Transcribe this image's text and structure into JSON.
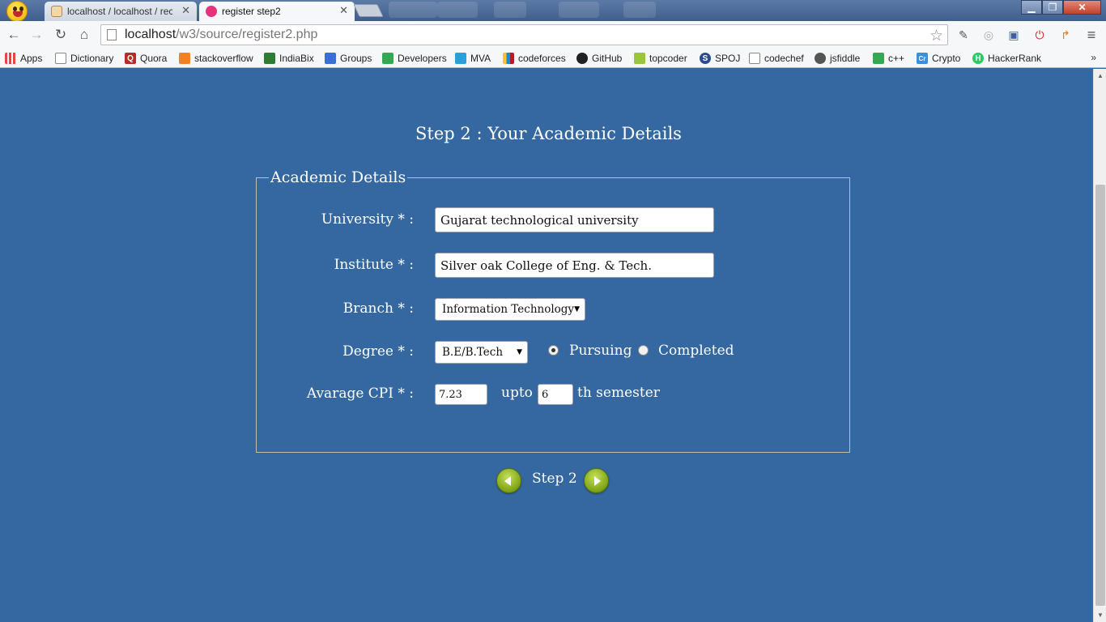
{
  "browser": {
    "tabs": [
      {
        "title": "localhost / localhost / rec",
        "favicon": "phpmyadmin-icon",
        "active": false
      },
      {
        "title": "register step2",
        "favicon": "page-icon",
        "active": true
      }
    ],
    "close_glyph": "✕",
    "url_host": "localhost",
    "url_path": "/w3/source/register2.php",
    "bookmarks": [
      {
        "label": "Apps",
        "icon": "apps-icon",
        "color": "#e8453c"
      },
      {
        "label": "Dictionary",
        "icon": "page-icon",
        "color": "#ffffff"
      },
      {
        "label": "Quora",
        "icon": "quora-icon",
        "color": "#b92b27",
        "glyph": "Q"
      },
      {
        "label": "stackoverflow",
        "icon": "stackoverflow-icon",
        "color": "#f48024"
      },
      {
        "label": "IndiaBix",
        "icon": "indiabix-icon",
        "color": "#2f7d32"
      },
      {
        "label": "Groups",
        "icon": "groups-icon",
        "color": "#3b6fd8"
      },
      {
        "label": "Developers",
        "icon": "developers-icon",
        "color": "#34a853"
      },
      {
        "label": "MVA",
        "icon": "mva-icon",
        "color": "#2aa0da"
      },
      {
        "label": "codeforces",
        "icon": "codeforces-icon",
        "color": "#1f8acb"
      },
      {
        "label": "GitHub",
        "icon": "github-icon",
        "color": "#222222"
      },
      {
        "label": "topcoder",
        "icon": "topcoder-icon",
        "color": "#9bc53d"
      },
      {
        "label": "SPOJ",
        "icon": "spoj-icon",
        "color": "#2b4c8c",
        "glyph": "S"
      },
      {
        "label": "codechef",
        "icon": "page-icon",
        "color": "#ffffff"
      },
      {
        "label": "jsfiddle",
        "icon": "jsfiddle-icon",
        "color": "#555555"
      },
      {
        "label": "c++",
        "icon": "cpp-icon",
        "color": "#34a853"
      },
      {
        "label": "Crypto",
        "icon": "crypto-icon",
        "color": "#3b8fd8",
        "glyph": "Cr"
      },
      {
        "label": "HackerRank",
        "icon": "hackerrank-icon",
        "color": "#2ec866",
        "glyph": "H"
      }
    ],
    "bookmarks_more": "»"
  },
  "page": {
    "title": "Step 2 : Your Academic Details",
    "legend": "Academic Details",
    "fields": {
      "university": {
        "label": "University * :",
        "value": "Gujarat technological university"
      },
      "institute": {
        "label": "Institute * :",
        "value": "Silver oak College of Eng. & Tech."
      },
      "branch": {
        "label": "Branch * :",
        "selected": "Information Technology"
      },
      "degree": {
        "label": "Degree * :",
        "selected": "B.E/B.Tech",
        "status_options": [
          "Pursuing",
          "Completed"
        ],
        "status_selected": "Pursuing"
      },
      "cpi": {
        "label": "Avarage CPI * :",
        "value": "7.23",
        "upto_text": "upto",
        "semester": "6",
        "semester_suffix": "th semester"
      }
    },
    "footer": {
      "step_label": "Step 2"
    }
  }
}
